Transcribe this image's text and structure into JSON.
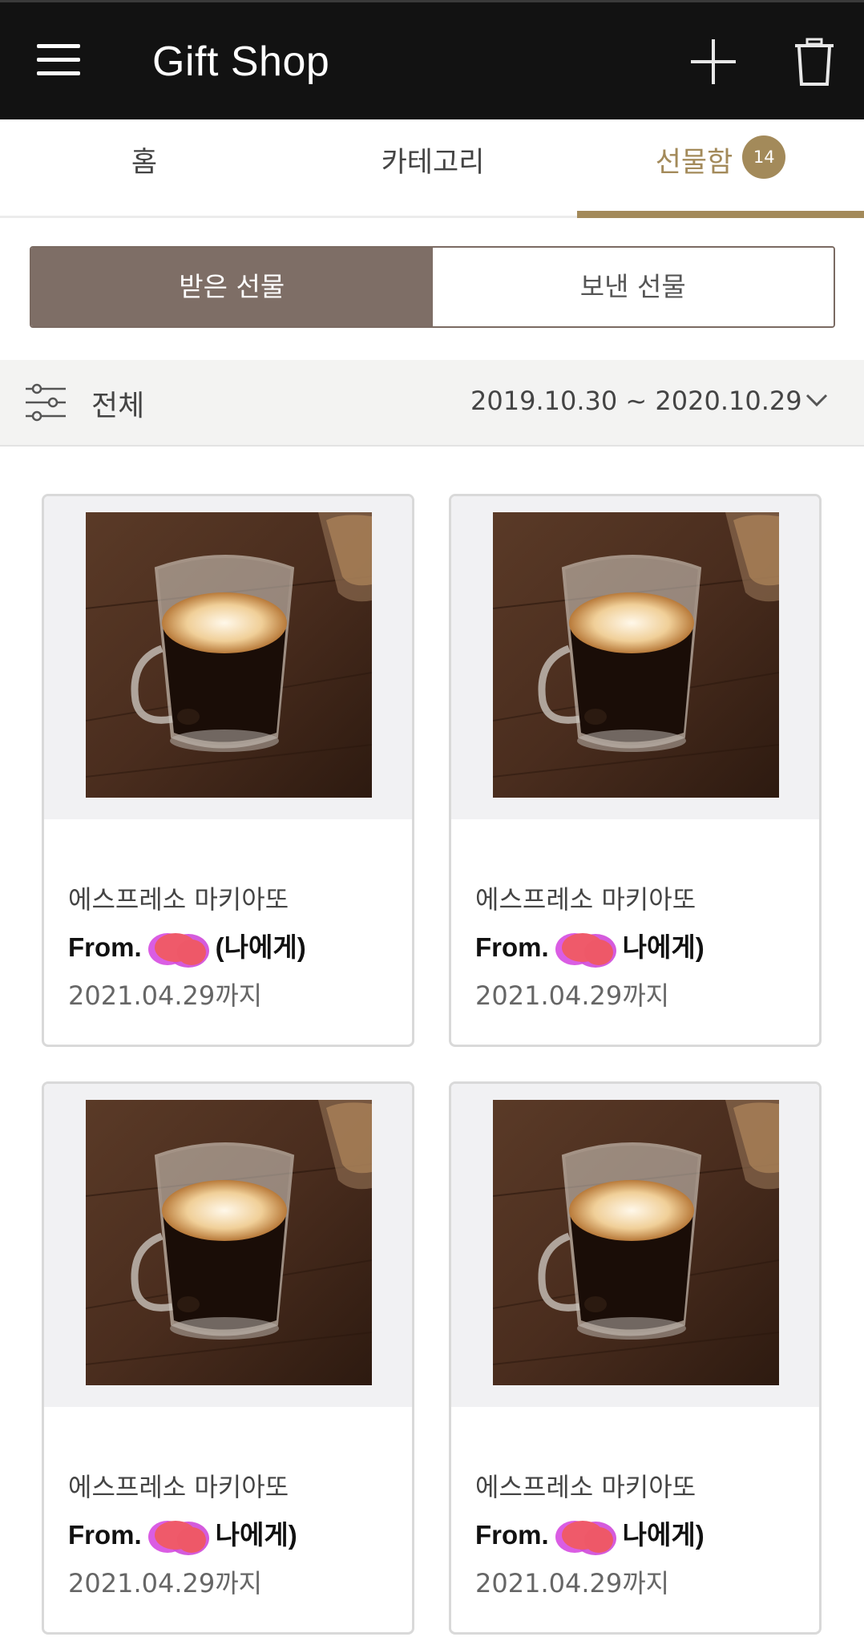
{
  "header": {
    "title": "Gift Shop",
    "icons": [
      "menu-icon",
      "plus-icon",
      "trash-icon"
    ]
  },
  "tabs": [
    {
      "label": "홈"
    },
    {
      "label": "카테고리"
    },
    {
      "label": "선물함",
      "badge": "14",
      "active": true
    }
  ],
  "segmented": {
    "received": "받은 선물",
    "sent": "보낸 선물",
    "selected": "received"
  },
  "filter": {
    "label": "전체",
    "date_range": "2019.10.30 ~ 2020.10.29"
  },
  "gifts": [
    {
      "name": "에스프레소 마키아또",
      "from_prefix": "From.",
      "from_suffix": "(나에게)",
      "expires": "2021.04.29까지"
    },
    {
      "name": "에스프레소 마키아또",
      "from_prefix": "From.",
      "from_suffix": "나에게)",
      "expires": "2021.04.29까지"
    },
    {
      "name": "에스프레소 마키아또",
      "from_prefix": "From.",
      "from_suffix": "나에게)",
      "expires": "2021.04.29까지"
    },
    {
      "name": "에스프레소 마키아또",
      "from_prefix": "From.",
      "from_suffix": "나에게)",
      "expires": "2021.04.29까지"
    }
  ],
  "colors": {
    "header_bg": "#121212",
    "accent_gold": "#a38a5a",
    "segment_active": "#7e6e66"
  }
}
